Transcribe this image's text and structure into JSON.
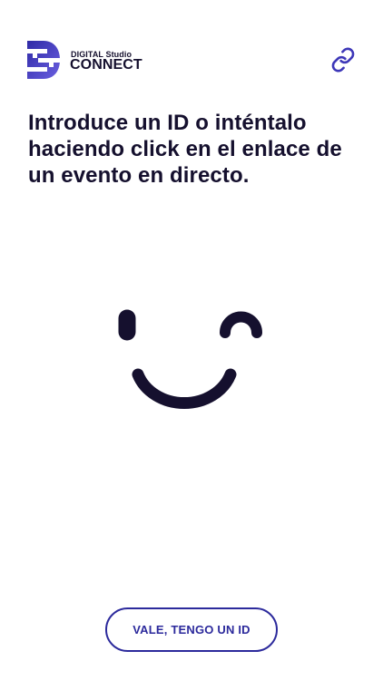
{
  "brand": {
    "name_small": "DIGITAL Studio",
    "name_big": "CONNECT",
    "primary_color": "#3d37b8",
    "mark_gradient": [
      "#3a2fb0",
      "#5b4fd6",
      "#7a6ee6"
    ]
  },
  "header": {
    "link_icon": "link-icon"
  },
  "main": {
    "headline": "Introduce un ID o inténtalo haciendo click en el enlace de un evento en directo.",
    "illustration": "smiley-wink-illustration"
  },
  "footer": {
    "cta_label": "VALE, TENGO UN ID"
  },
  "colors": {
    "text": "#15102e",
    "accent": "#2c2a9c",
    "background": "#ffffff"
  }
}
